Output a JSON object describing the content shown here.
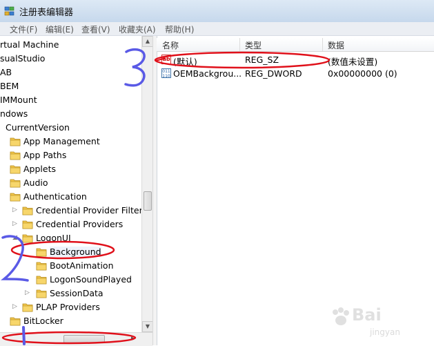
{
  "window": {
    "title": "注册表编辑器"
  },
  "menu": [
    "文件(F)",
    "编辑(E)",
    "查看(V)",
    "收藏夹(A)",
    "帮助(H)"
  ],
  "tree": {
    "items": [
      {
        "label": "rtual Machine",
        "arrow": "",
        "folder": false
      },
      {
        "label": "sualStudio",
        "arrow": "",
        "folder": false
      },
      {
        "label": "AB",
        "arrow": "",
        "folder": false
      },
      {
        "label": "BEM",
        "arrow": "",
        "folder": false
      },
      {
        "label": "IMMount",
        "arrow": "",
        "folder": false
      },
      {
        "label": "ndows",
        "arrow": "",
        "folder": false
      },
      {
        "label": "CurrentVersion",
        "arrow": "",
        "folder": false
      },
      {
        "label": "App Management",
        "arrow": "",
        "folder": true
      },
      {
        "label": "App Paths",
        "arrow": "",
        "folder": true
      },
      {
        "label": "Applets",
        "arrow": "",
        "folder": true
      },
      {
        "label": "Audio",
        "arrow": "",
        "folder": true
      },
      {
        "label": "Authentication",
        "arrow": "",
        "folder": true
      },
      {
        "label": "Credential Provider Filters",
        "arrow": "▷",
        "folder": true
      },
      {
        "label": "Credential Providers",
        "arrow": "▷",
        "folder": true
      },
      {
        "label": "LogonUI",
        "arrow": "◢",
        "folder": true
      },
      {
        "label": "Background",
        "arrow": "",
        "folder": true
      },
      {
        "label": "BootAnimation",
        "arrow": "",
        "folder": true
      },
      {
        "label": "LogonSoundPlayed",
        "arrow": "",
        "folder": true
      },
      {
        "label": "SessionData",
        "arrow": "▷",
        "folder": true
      },
      {
        "label": "PLAP Providers",
        "arrow": "▷",
        "folder": true
      },
      {
        "label": "BitLocker",
        "arrow": "",
        "folder": true
      }
    ]
  },
  "columns": {
    "name": "名称",
    "type": "类型",
    "data": "数据"
  },
  "values": [
    {
      "icon": "string-value-icon",
      "name": "(默认)",
      "type": "REG_SZ",
      "data": "(数值未设置)"
    },
    {
      "icon": "binary-value-icon",
      "name": "OEMBackgrou...",
      "type": "REG_DWORD",
      "data": "0x00000000 (0)"
    }
  ],
  "colors": {
    "annotation_red": "#e0101a",
    "annotation_blue": "#5a5ae6",
    "selection": "#eef3fb"
  },
  "watermark": {
    "brand": "Bai",
    "sub": "jingyan"
  }
}
